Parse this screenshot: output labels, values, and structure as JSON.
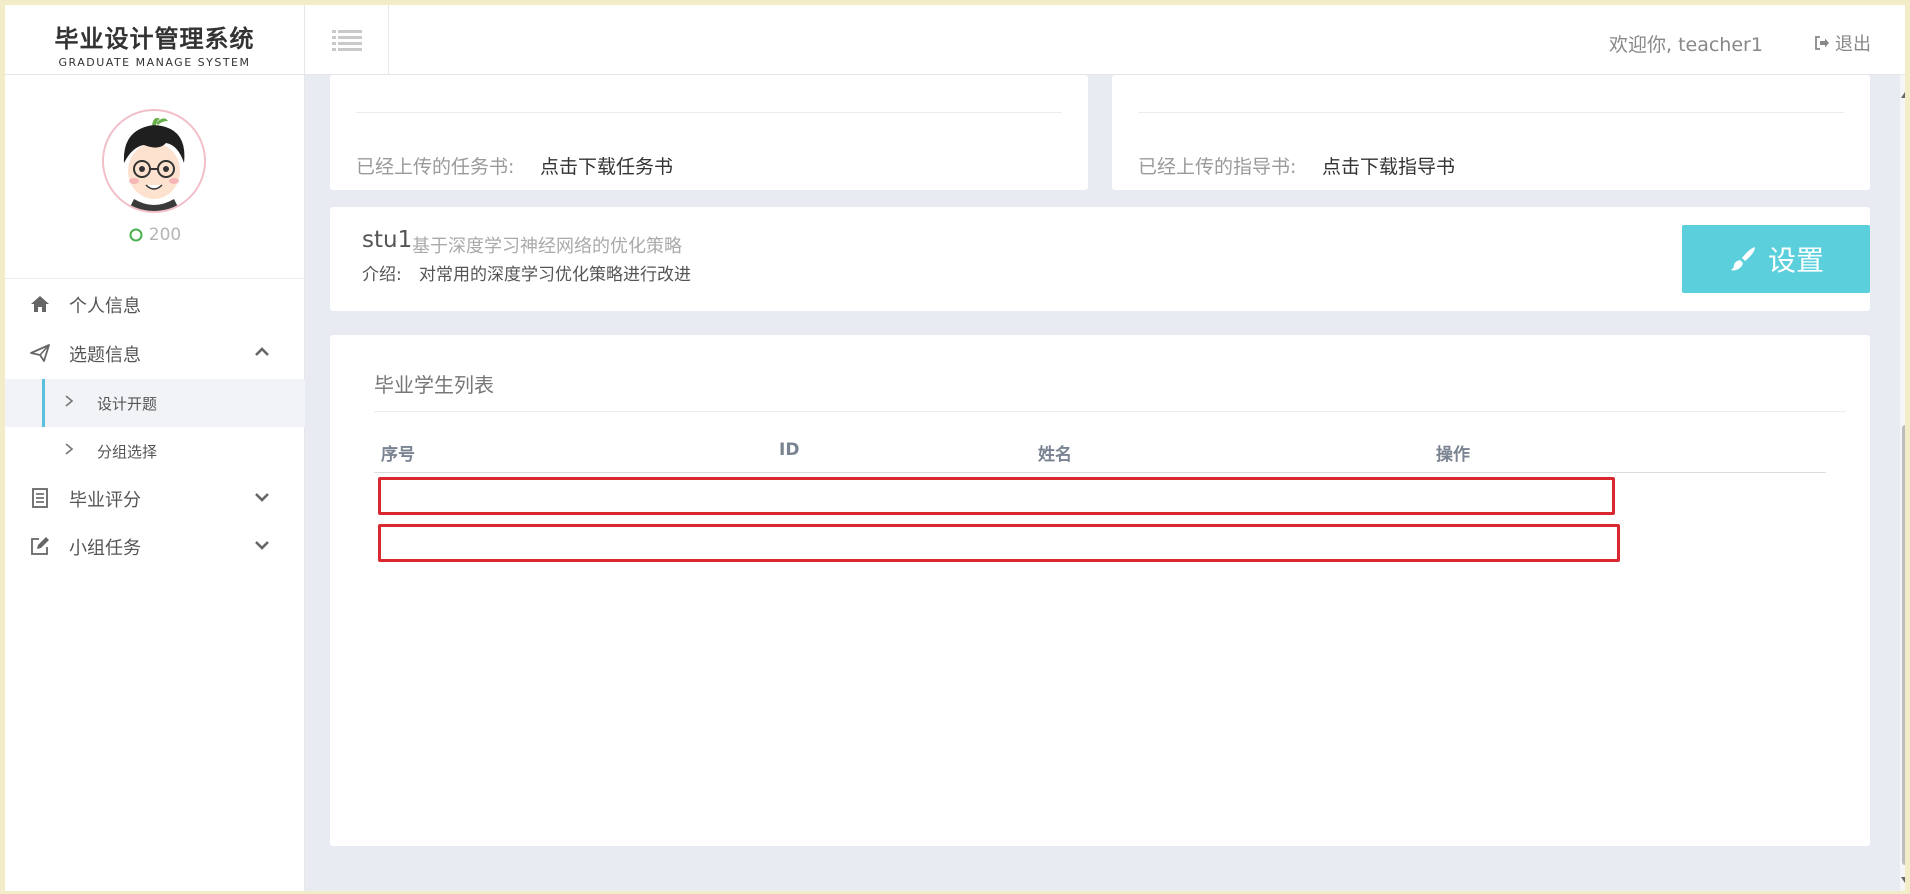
{
  "header": {
    "logo_cn": "毕业设计管理系统",
    "logo_en": "GRADUATE MANAGE SYSTEM",
    "welcome": "欢迎你, teacher1",
    "logout": "退出"
  },
  "sidebar": {
    "points": "200",
    "items": [
      {
        "label": "个人信息",
        "icon": "home-icon"
      },
      {
        "label": "选题信息",
        "icon": "paper-plane-icon",
        "expanded": true
      },
      {
        "label": "毕业评分",
        "icon": "calculator-icon",
        "expanded": false
      },
      {
        "label": "小组任务",
        "icon": "edit-icon",
        "expanded": false
      }
    ],
    "sub_items": [
      {
        "label": "设计开题",
        "active": true
      },
      {
        "label": "分组选择",
        "active": false
      }
    ]
  },
  "task_panel": {
    "label": "已经上传的任务书:",
    "link": "点击下载任务书"
  },
  "guide_panel": {
    "label": "已经上传的指导书:",
    "link": "点击下载指导书"
  },
  "topic": {
    "student": "stu1",
    "title": "基于深度学习神经网络的优化策略",
    "intro_label": "介绍:",
    "intro_text": "对常用的深度学习优化策略进行改进",
    "settings_label": "设置"
  },
  "student_list": {
    "title": "毕业学生列表",
    "columns": [
      "序号",
      "ID",
      "姓名",
      "操作"
    ],
    "rows": [
      [],
      []
    ]
  },
  "colors": {
    "accent": "#5bd0dc",
    "highlight_border": "#d9282f",
    "active_bar": "#5bc0de"
  }
}
